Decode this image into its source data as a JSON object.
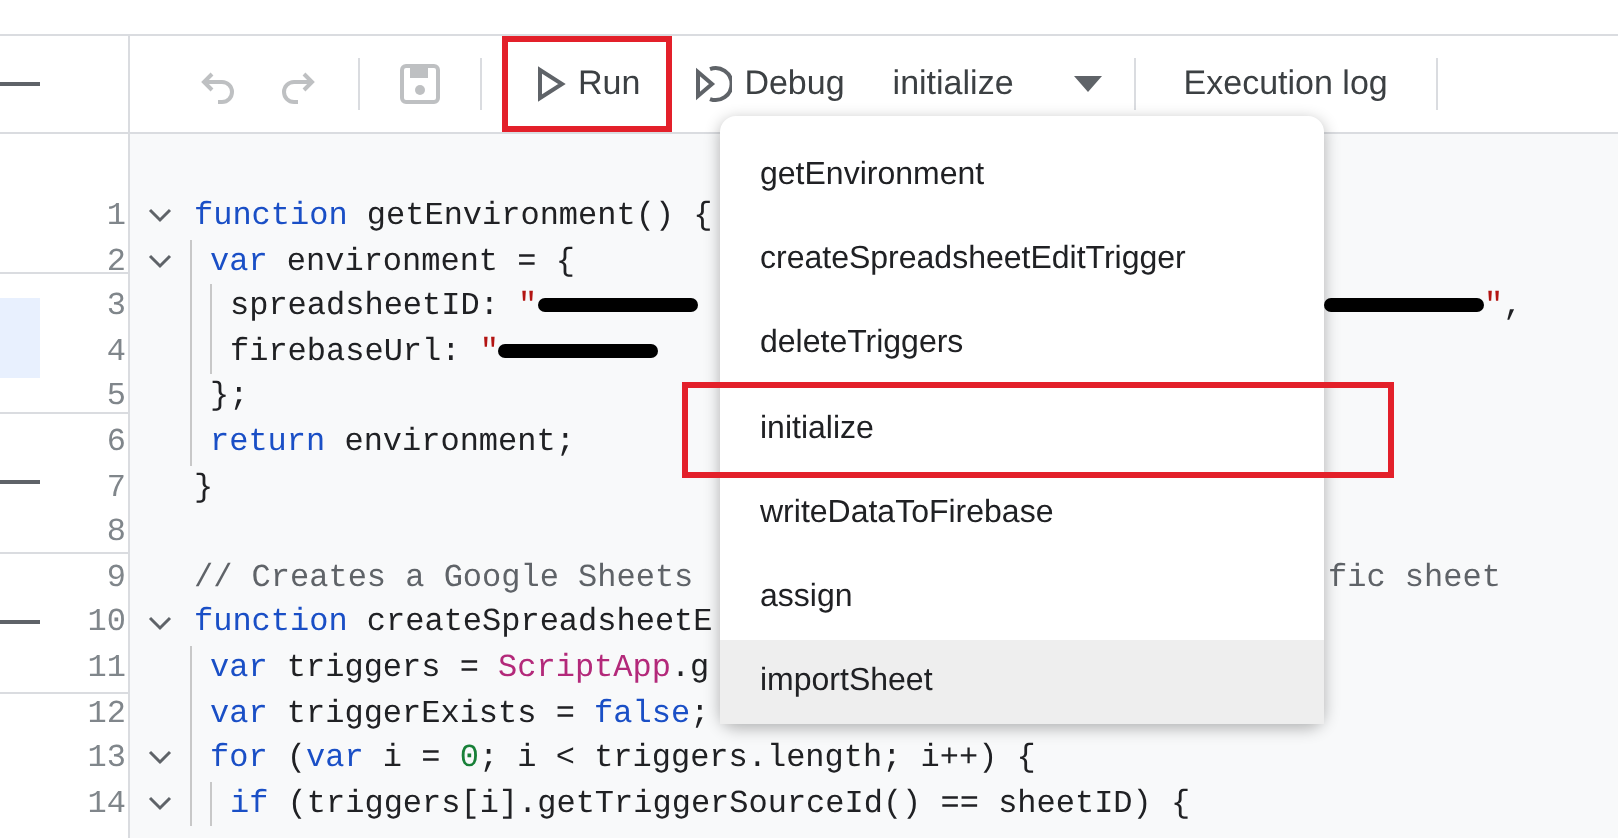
{
  "toolbar": {
    "undo": {
      "disabled": true
    },
    "redo": {
      "disabled": true
    },
    "save": {
      "disabled": true
    },
    "buttons": [
      {
        "kind": "run",
        "label": "Run",
        "highlighted": true
      },
      {
        "kind": "debug",
        "label": "Debug",
        "highlighted": false
      },
      {
        "kind": "select",
        "label": "initialize",
        "highlighted": false
      },
      {
        "kind": "log",
        "label": "Execution log",
        "highlighted": false
      }
    ]
  },
  "sidebar": {
    "items": [
      {
        "selected": false
      },
      {
        "selected": true
      },
      {
        "selected": false
      },
      {
        "selected": false
      }
    ]
  },
  "editor": {
    "lines": [
      {
        "number": "1",
        "foldable": true,
        "tokens": [
          {
            "kind": "kw",
            "text": "function"
          },
          {
            "kind": "plain",
            "text": " getEnvironment() {"
          }
        ],
        "children": [
          {
            "number": "2",
            "foldable": true,
            "tokens": [
              {
                "kind": "kw",
                "text": "var"
              },
              {
                "kind": "plain",
                "text": " environment = {"
              }
            ],
            "children": [
              {
                "number": "3",
                "foldable": false,
                "tokens": [
                  {
                    "kind": "plain",
                    "text": "spreadsheetID: "
                  },
                  {
                    "kind": "str",
                    "text": "\""
                  },
                  {
                    "kind": "redacted"
                  }
                ],
                "tail": [
                  {
                    "kind": "redacted"
                  },
                  {
                    "kind": "str",
                    "text": "\""
                  },
                  {
                    "kind": "plain",
                    "text": ","
                  }
                ]
              },
              {
                "number": "4",
                "foldable": false,
                "tokens": [
                  {
                    "kind": "plain",
                    "text": "firebaseUrl: "
                  },
                  {
                    "kind": "str",
                    "text": "\""
                  },
                  {
                    "kind": "redacted"
                  }
                ]
              }
            ]
          },
          {
            "number": "5",
            "foldable": false,
            "tokens": [
              {
                "kind": "plain",
                "text": "};"
              }
            ]
          },
          {
            "number": "6",
            "foldable": false,
            "tokens": [
              {
                "kind": "kw",
                "text": "return"
              },
              {
                "kind": "plain",
                "text": " environment;"
              }
            ]
          }
        ]
      },
      {
        "number": "7",
        "foldable": false,
        "tokens": [
          {
            "kind": "plain",
            "text": "}"
          }
        ]
      },
      {
        "number": "8",
        "foldable": false
      },
      {
        "number": "9",
        "foldable": false,
        "tokens": [
          {
            "kind": "comment",
            "text": "// Creates a Google Sheets"
          }
        ],
        "tail": [
          {
            "kind": "comment",
            "text": "fic sheet"
          }
        ]
      },
      {
        "number": "10",
        "foldable": true,
        "tokens": [
          {
            "kind": "kw",
            "text": "function"
          },
          {
            "kind": "plain",
            "text": " createSpreadsheetE"
          }
        ],
        "children": [
          {
            "number": "11",
            "foldable": false,
            "tokens": [
              {
                "kind": "kw",
                "text": "var"
              },
              {
                "kind": "plain",
                "text": " triggers = "
              },
              {
                "kind": "cls",
                "text": "ScriptApp"
              },
              {
                "kind": "plain",
                "text": ".g"
              }
            ]
          },
          {
            "number": "12",
            "foldable": false,
            "tokens": [
              {
                "kind": "kw",
                "text": "var"
              },
              {
                "kind": "plain",
                "text": " triggerExists = "
              },
              {
                "kind": "kw",
                "text": "false"
              },
              {
                "kind": "plain",
                "text": ";"
              }
            ]
          },
          {
            "number": "13",
            "foldable": true,
            "tokens": [
              {
                "kind": "kw",
                "text": "for"
              },
              {
                "kind": "plain",
                "text": " ("
              },
              {
                "kind": "kw",
                "text": "var"
              },
              {
                "kind": "plain",
                "text": " i = "
              },
              {
                "kind": "num",
                "text": "0"
              },
              {
                "kind": "plain",
                "text": "; i < triggers.length; i++) {"
              }
            ],
            "children": [
              {
                "number": "14",
                "foldable": true,
                "tokens": [
                  {
                    "kind": "kw",
                    "text": "if"
                  },
                  {
                    "kind": "plain",
                    "text": " (triggers[i].getTriggerSourceId() == sheetID) {"
                  }
                ]
              }
            ]
          }
        ]
      }
    ]
  },
  "function_menu": {
    "items": [
      {
        "label": "getEnvironment",
        "hovered": false,
        "highlighted": false
      },
      {
        "label": "createSpreadsheetEditTrigger",
        "hovered": false,
        "highlighted": false
      },
      {
        "label": "deleteTriggers",
        "hovered": false,
        "highlighted": false
      },
      {
        "label": "initialize",
        "hovered": false,
        "highlighted": true
      },
      {
        "label": "writeDataToFirebase",
        "hovered": false,
        "highlighted": false
      },
      {
        "label": "assign",
        "hovered": false,
        "highlighted": false
      },
      {
        "label": "importSheet",
        "hovered": true,
        "highlighted": false
      }
    ]
  }
}
